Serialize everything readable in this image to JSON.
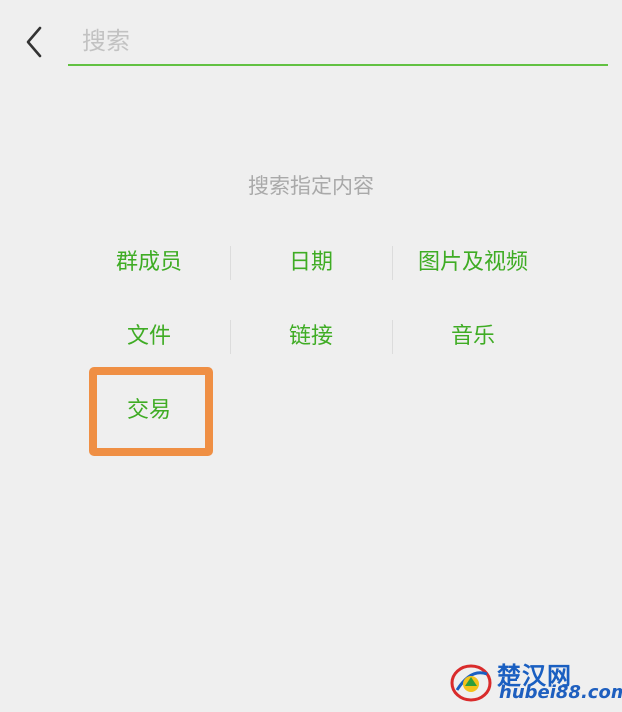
{
  "search": {
    "placeholder": "搜索",
    "value": ""
  },
  "section_title": "搜索指定内容",
  "categories": {
    "row1": [
      "群成员",
      "日期",
      "图片及视频"
    ],
    "row2": [
      "文件",
      "链接",
      "音乐"
    ],
    "row3": [
      "交易"
    ]
  },
  "watermark": {
    "title": "楚汉网",
    "subtitle": "hubei88.com"
  },
  "colors": {
    "accent_green": "#3fac24",
    "underline_green": "#62c142",
    "highlight_orange": "#ef8f44",
    "background": "#efefef",
    "hint_gray": "#a9a9a9"
  }
}
